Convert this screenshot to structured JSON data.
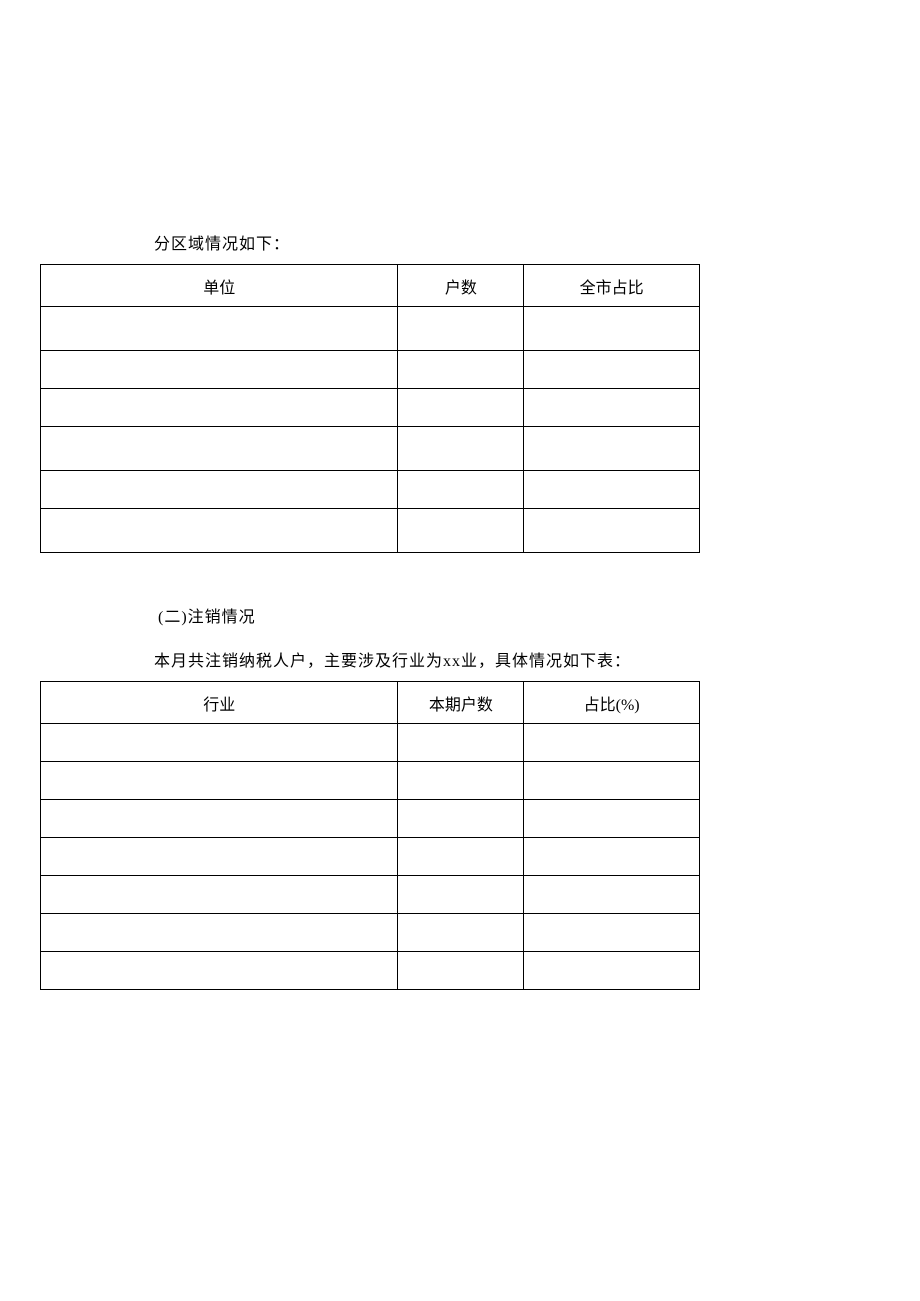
{
  "section1": {
    "intro": "分区域情况如下：",
    "table": {
      "headers": [
        "单位",
        "户数",
        "全市占比"
      ],
      "rows": [
        [
          "",
          "",
          ""
        ],
        [
          "",
          "",
          ""
        ],
        [
          "",
          "",
          ""
        ],
        [
          "",
          "",
          ""
        ],
        [
          "",
          "",
          ""
        ],
        [
          "",
          "",
          ""
        ]
      ]
    }
  },
  "section2": {
    "heading": "(二)注销情况",
    "paragraph": "本月共注销纳税人户，主要涉及行业为xx业，具体情况如下表：",
    "table": {
      "headers": [
        "行业",
        "本期户数",
        "占比(%)"
      ],
      "rows": [
        [
          "",
          "",
          ""
        ],
        [
          "",
          "",
          ""
        ],
        [
          "",
          "",
          ""
        ],
        [
          "",
          "",
          ""
        ],
        [
          "",
          "",
          ""
        ],
        [
          "",
          "",
          ""
        ],
        [
          "",
          "",
          ""
        ]
      ]
    }
  }
}
